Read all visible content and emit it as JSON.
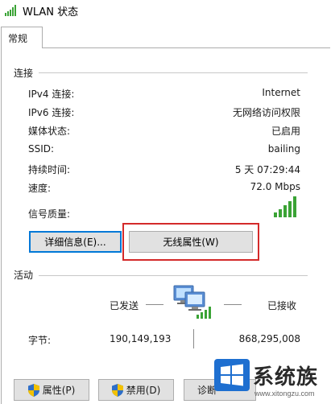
{
  "window": {
    "title": "WLAN 状态"
  },
  "tabs": [
    {
      "label": "常规"
    }
  ],
  "connection": {
    "section_label": "连接",
    "rows": [
      {
        "label": "IPv4 连接:",
        "value": "Internet"
      },
      {
        "label": "IPv6 连接:",
        "value": "无网络访问权限"
      },
      {
        "label": "媒体状态:",
        "value": "已启用"
      },
      {
        "label": "SSID:",
        "value": "bailing"
      },
      {
        "label": "持续时间:",
        "value": "5 天 07:29:44"
      },
      {
        "label": "速度:",
        "value": "72.0 Mbps"
      }
    ],
    "signal_label": "信号质量:",
    "signal_bars": 5,
    "details_button": "详细信息(E)...",
    "wireless_props_button": "无线属性(W)"
  },
  "activity": {
    "section_label": "活动",
    "sent_label": "已发送",
    "received_label": "已接收",
    "bytes_label": "字节:",
    "bytes_sent": "190,149,193",
    "bytes_received": "868,295,008"
  },
  "footer": {
    "properties_button": "属性(P)",
    "disable_button": "禁用(D)",
    "diagnose_button": "诊断"
  },
  "watermark": {
    "text": "系统族",
    "url": "www.xitongzu.com"
  },
  "colors": {
    "highlight": "#d42a2a",
    "signal_green": "#3aa335",
    "focus": "#0078d7"
  }
}
